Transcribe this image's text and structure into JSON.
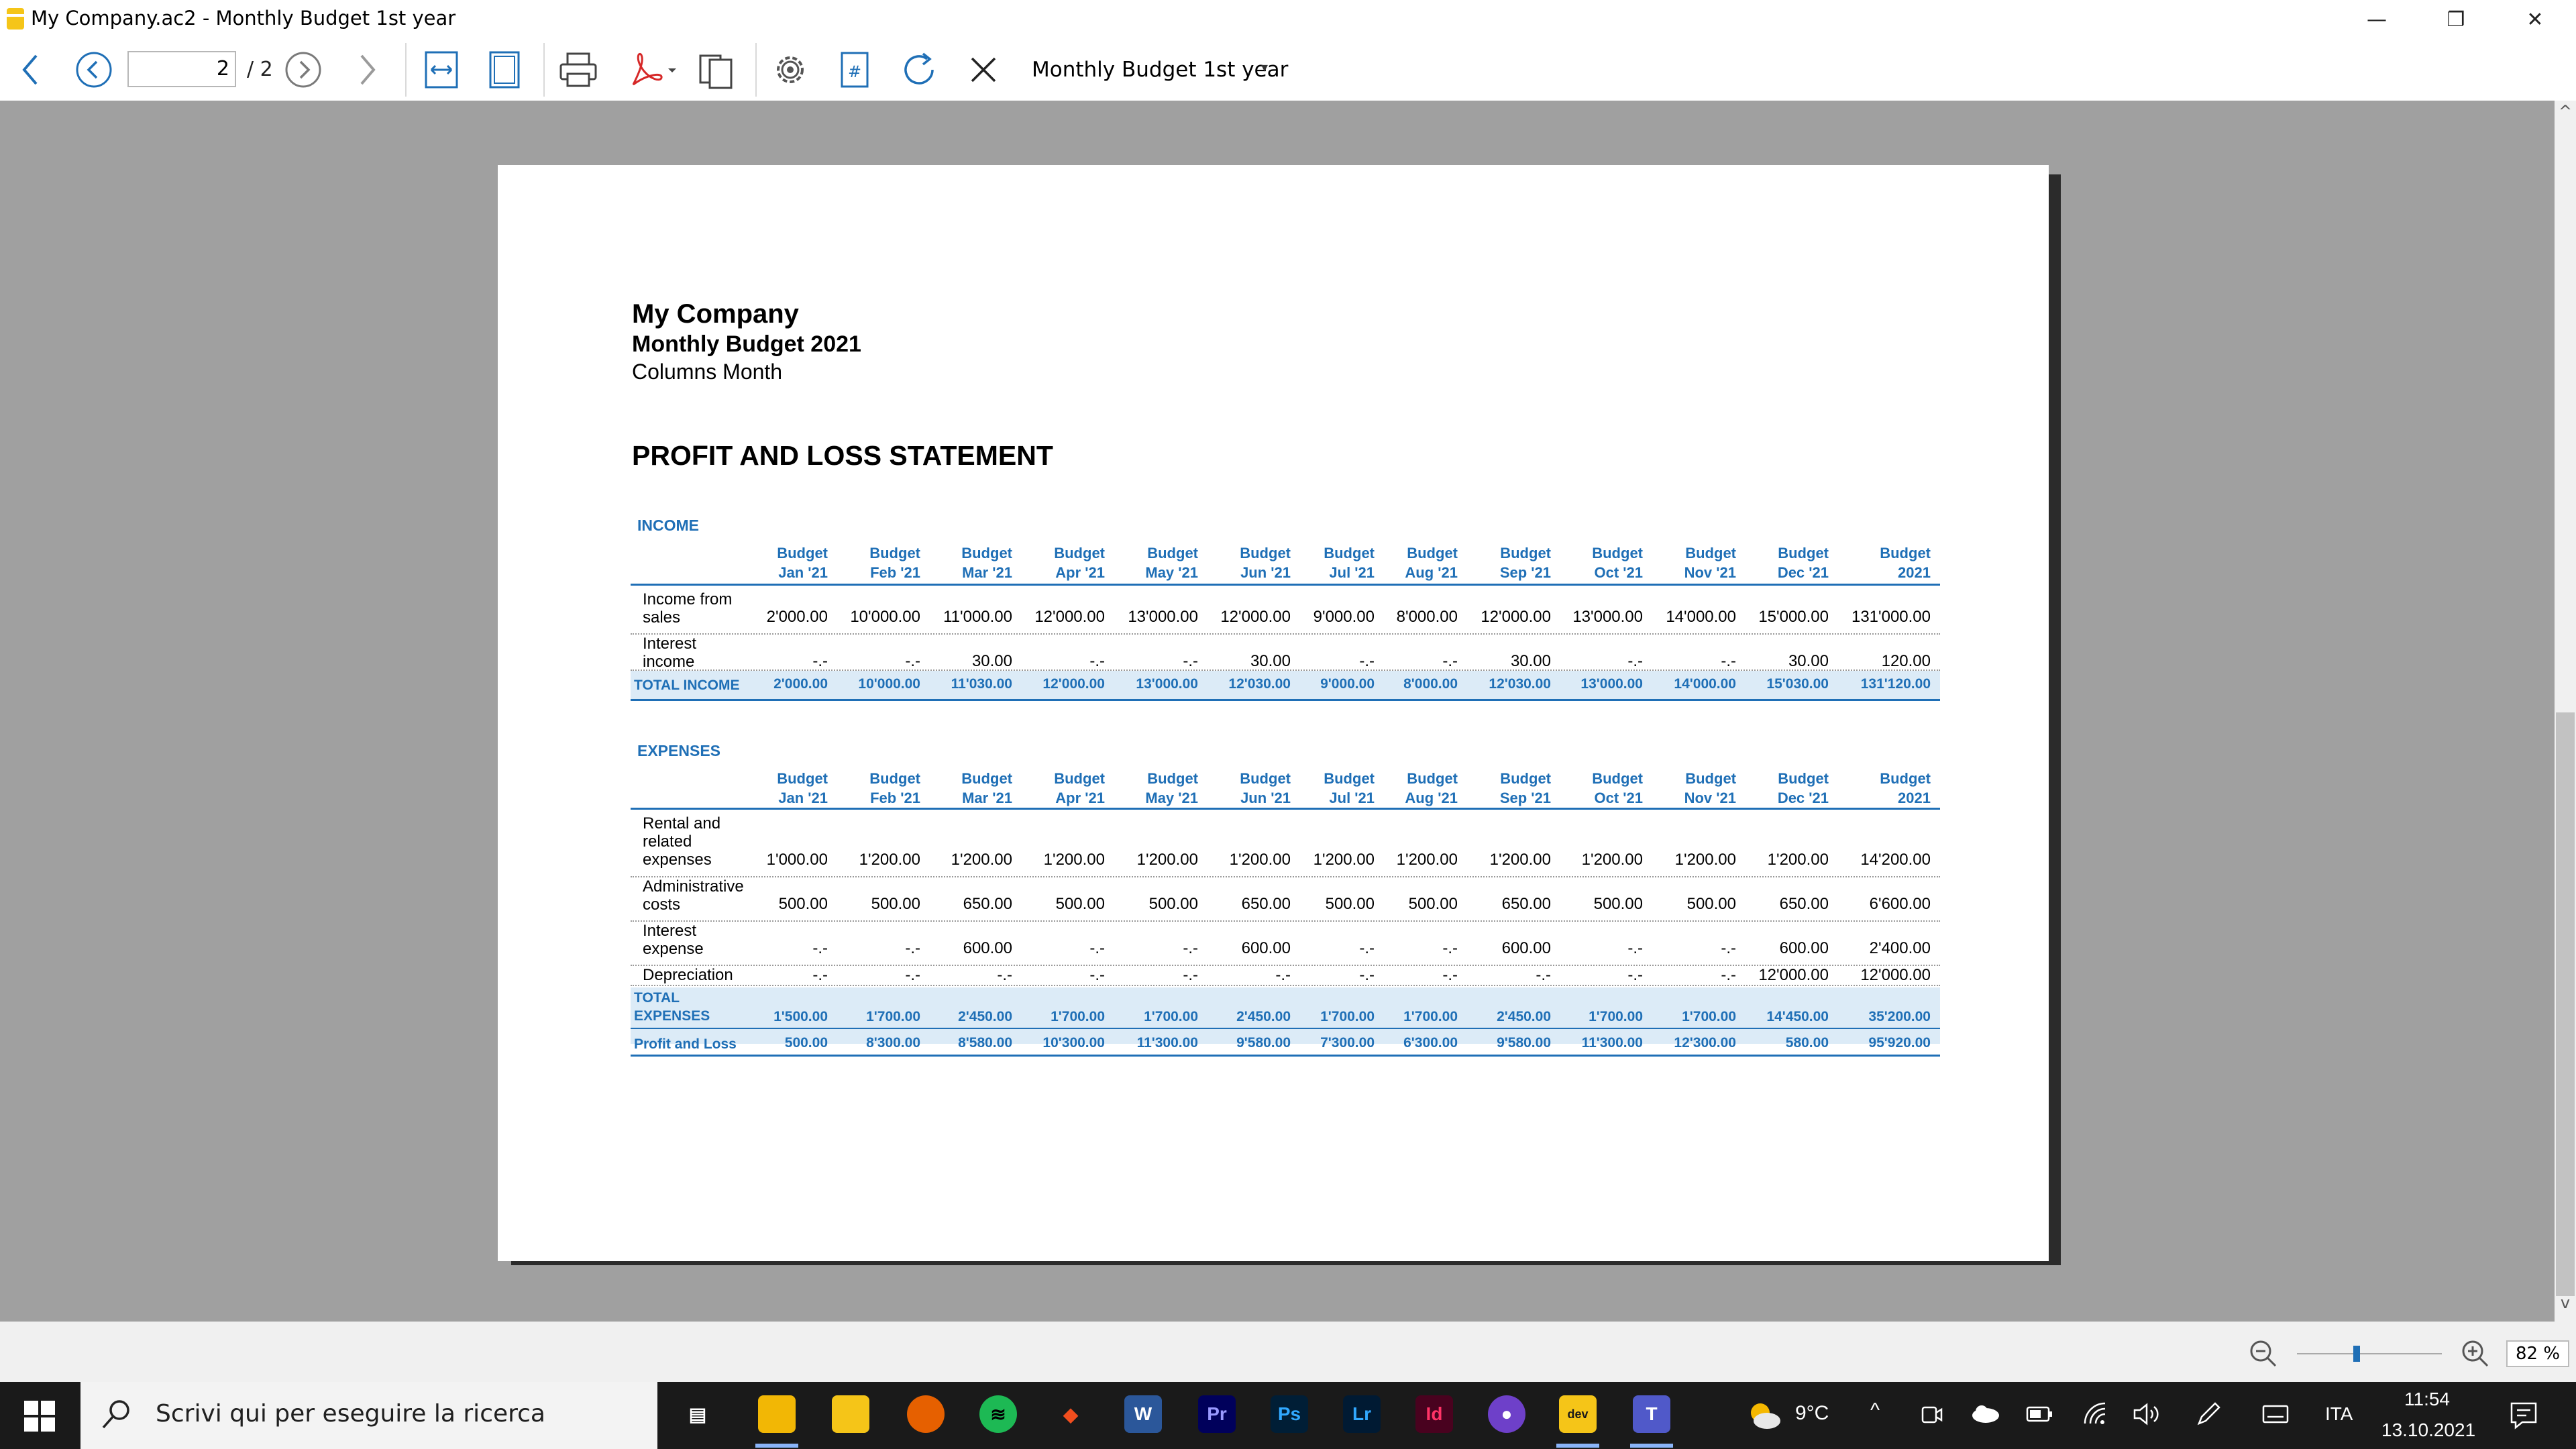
{
  "window": {
    "title": "My Company.ac2 - Monthly Budget 1st year",
    "minimize": "—",
    "maximize": "❐",
    "close": "✕"
  },
  "toolbar": {
    "page_value": "2",
    "page_total": "/ 2",
    "report_name": "Monthly Budget 1st year",
    "report_caret": "▾"
  },
  "report": {
    "company": "My Company",
    "subtitle": "Monthly Budget 2021",
    "columns_note": "Columns Month",
    "statement_title": "PROFIT AND LOSS STATEMENT",
    "column_headers": [
      {
        "line1": "Budget",
        "line2": "Jan '21"
      },
      {
        "line1": "Budget",
        "line2": "Feb '21"
      },
      {
        "line1": "Budget",
        "line2": "Mar '21"
      },
      {
        "line1": "Budget",
        "line2": "Apr '21"
      },
      {
        "line1": "Budget",
        "line2": "May '21"
      },
      {
        "line1": "Budget",
        "line2": "Jun '21"
      },
      {
        "line1": "Budget",
        "line2": "Jul '21"
      },
      {
        "line1": "Budget",
        "line2": "Aug '21"
      },
      {
        "line1": "Budget",
        "line2": "Sep '21"
      },
      {
        "line1": "Budget",
        "line2": "Oct '21"
      },
      {
        "line1": "Budget",
        "line2": "Nov '21"
      },
      {
        "line1": "Budget",
        "line2": "Dec '21"
      },
      {
        "line1": "Budget",
        "line2": "2021"
      }
    ],
    "income": {
      "section_label": "INCOME",
      "rows": [
        {
          "label": "Income from sales",
          "values": [
            "2'000.00",
            "10'000.00",
            "11'000.00",
            "12'000.00",
            "13'000.00",
            "12'000.00",
            "9'000.00",
            "8'000.00",
            "12'000.00",
            "13'000.00",
            "14'000.00",
            "15'000.00",
            "131'000.00"
          ]
        },
        {
          "label": "Interest income",
          "values": [
            "-.-",
            "-.-",
            "30.00",
            "-.-",
            "-.-",
            "30.00",
            "-.-",
            "-.-",
            "30.00",
            "-.-",
            "-.-",
            "30.00",
            "120.00"
          ]
        }
      ],
      "total": {
        "label": "TOTAL INCOME",
        "values": [
          "2'000.00",
          "10'000.00",
          "11'030.00",
          "12'000.00",
          "13'000.00",
          "12'030.00",
          "9'000.00",
          "8'000.00",
          "12'030.00",
          "13'000.00",
          "14'000.00",
          "15'030.00",
          "131'120.00"
        ]
      }
    },
    "expenses": {
      "section_label": "EXPENSES",
      "rows": [
        {
          "label": "Rental and related expenses",
          "values": [
            "1'000.00",
            "1'200.00",
            "1'200.00",
            "1'200.00",
            "1'200.00",
            "1'200.00",
            "1'200.00",
            "1'200.00",
            "1'200.00",
            "1'200.00",
            "1'200.00",
            "1'200.00",
            "14'200.00"
          ]
        },
        {
          "label": "Administrative costs",
          "values": [
            "500.00",
            "500.00",
            "650.00",
            "500.00",
            "500.00",
            "650.00",
            "500.00",
            "500.00",
            "650.00",
            "500.00",
            "500.00",
            "650.00",
            "6'600.00"
          ]
        },
        {
          "label": "Interest expense",
          "values": [
            "-.-",
            "-.-",
            "600.00",
            "-.-",
            "-.-",
            "600.00",
            "-.-",
            "-.-",
            "600.00",
            "-.-",
            "-.-",
            "600.00",
            "2'400.00"
          ]
        },
        {
          "label": "Depreciation",
          "values": [
            "-.-",
            "-.-",
            "-.-",
            "-.-",
            "-.-",
            "-.-",
            "-.-",
            "-.-",
            "-.-",
            "-.-",
            "-.-",
            "12'000.00",
            "12'000.00"
          ]
        }
      ],
      "total": {
        "label": "TOTAL EXPENSES",
        "values": [
          "1'500.00",
          "1'700.00",
          "2'450.00",
          "1'700.00",
          "1'700.00",
          "2'450.00",
          "1'700.00",
          "1'700.00",
          "2'450.00",
          "1'700.00",
          "1'700.00",
          "14'450.00",
          "35'200.00"
        ]
      }
    },
    "profit_loss": {
      "label": "Profit and Loss",
      "values": [
        "500.00",
        "8'300.00",
        "8'580.00",
        "10'300.00",
        "11'300.00",
        "9'580.00",
        "7'300.00",
        "6'300.00",
        "9'580.00",
        "11'300.00",
        "12'300.00",
        "580.00",
        "95'920.00"
      ]
    }
  },
  "zoom": {
    "value": "82",
    "unit": "%"
  },
  "taskbar": {
    "search_placeholder": "Scrivi qui per eseguire la ricerca",
    "apps": [
      {
        "name": "task-view",
        "label": ""
      },
      {
        "name": "file-explorer",
        "label": ""
      },
      {
        "name": "notes",
        "label": ""
      },
      {
        "name": "firefox",
        "label": ""
      },
      {
        "name": "spotify",
        "label": ""
      },
      {
        "name": "figma",
        "label": ""
      },
      {
        "name": "word",
        "label": "W"
      },
      {
        "name": "premiere",
        "label": "Pr"
      },
      {
        "name": "photoshop",
        "label": "Ps"
      },
      {
        "name": "lightroom",
        "label": "Lr"
      },
      {
        "name": "indesign",
        "label": "Id"
      },
      {
        "name": "github",
        "label": ""
      },
      {
        "name": "banana-dev",
        "label": "dev"
      },
      {
        "name": "teams",
        "label": "T"
      }
    ],
    "weather": "9°C",
    "language": "ITA",
    "time": "11:54",
    "date": "13.10.2021"
  },
  "colors": {
    "accent": "#1f6fb6",
    "band": "#dcebf7"
  }
}
